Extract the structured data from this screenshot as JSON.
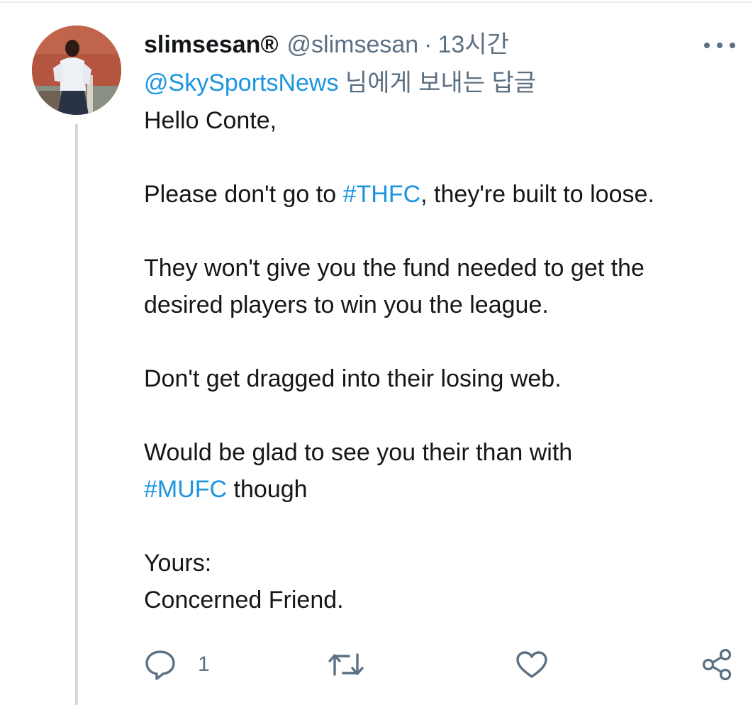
{
  "tweet": {
    "display_name": "slimsesan®",
    "handle": "@slimsesan",
    "separator": "·",
    "time": "13시간",
    "reply_to": {
      "mention": "@SkySportsNews",
      "suffix": " 님에게 보내는 답글"
    },
    "body": {
      "line1": "Hello Conte,",
      "p2_before": "Please don't go to ",
      "p2_hashtag": "#THFC",
      "p2_after": ", they're built to loose.",
      "p3_line1": "They won't give you the fund needed to get the",
      "p3_line2": "desired players to win you the league.",
      "p4": "Don't get dragged into their losing web.",
      "p5_line1": "Would be glad to see you their than with",
      "p5_hashtag": "#MUFC",
      "p5_after": " though",
      "p6_line1": "Yours:",
      "p6_line2": "Concerned Friend."
    }
  },
  "actions": {
    "reply_icon": "reply-bubble-icon",
    "reply_count": "1",
    "retweet_icon": "retweet-icon",
    "like_icon": "heart-icon",
    "share_icon": "share-icon"
  },
  "colors": {
    "link": "#1b95e0",
    "muted": "#5b7083",
    "text": "#14171a",
    "thread_line": "#cfd9de"
  }
}
